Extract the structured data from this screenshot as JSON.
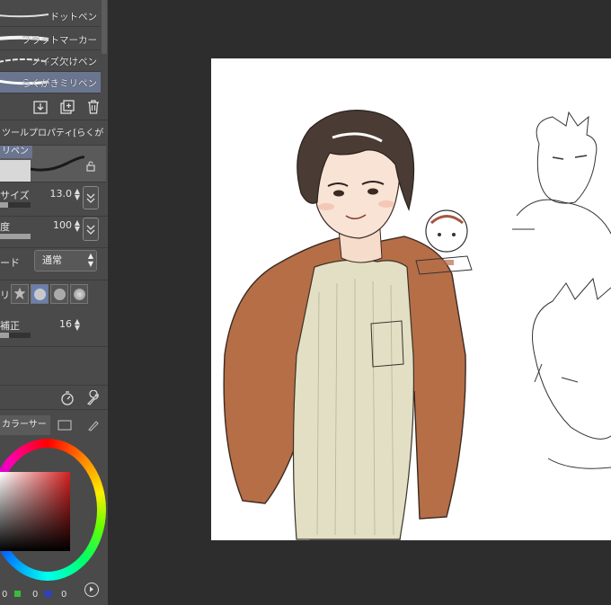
{
  "sub_tools": {
    "items": [
      {
        "label": "ドットペン"
      },
      {
        "label": "フラットマーカー"
      },
      {
        "label": "ノイズ欠けペン"
      },
      {
        "label": "らくがきミリペン",
        "selected": true
      }
    ]
  },
  "tool_property": {
    "header": "ツールプロパティ[らくが",
    "preview_tag": "リペン",
    "brush_size": {
      "label": "サイズ",
      "value": "13.0",
      "level": 0.25
    },
    "opacity": {
      "label": "度",
      "value": "100",
      "level": 1.0
    },
    "blend_mode": {
      "label": "ード",
      "value": "通常"
    },
    "brush_tip": {
      "label": "リ"
    },
    "stabilization": {
      "label": "補正",
      "value": "16",
      "level": 0.3
    }
  },
  "color_panel": {
    "tab_label": "カラーサー",
    "rgb": {
      "r": "0",
      "g": "0",
      "b": "0"
    },
    "colors": {
      "hue": "#d42020",
      "green_swatch": "#3bbb3b",
      "blue_swatch": "#2a3fd6"
    }
  },
  "icons": [
    "download-icon",
    "duplicate-icon",
    "trash-icon",
    "lock-icon",
    "pin-icon",
    "timer-icon",
    "wrench-icon",
    "play-icon"
  ]
}
